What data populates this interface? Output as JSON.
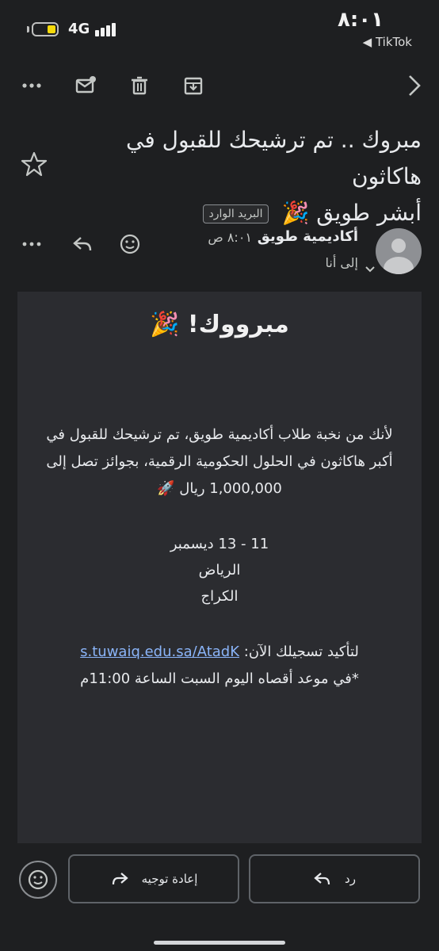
{
  "status_bar": {
    "network": "4G",
    "time": "٨:٠١",
    "source_app": "TikTok",
    "battery_color": "#f5d90a"
  },
  "toolbar": {
    "icons": [
      "more-icon",
      "mark-unread-icon",
      "delete-icon",
      "archive-icon",
      "next-chevron-icon"
    ]
  },
  "email": {
    "subject_line1": "مبروك .. تم ترشيحك للقبول في هاكاثون",
    "subject_line2": "أبشر طويق 🎉",
    "label": "البريد الوارد",
    "sender": {
      "name": "أكاديمية طويق",
      "time": "٨:٠١ ص",
      "recipient": "إلى أنا"
    },
    "body": {
      "title": "مبرووك! 🎉",
      "paragraph": "لأنك من نخبة طلاب أكاديمية طويق، تم ترشيحك للقبول في أكبر هاكاثون في الحلول الحكومية الرقمية، بجوائز تصل إلى 1,000,000 ريال 🚀",
      "date": "11 - 13 ديسمبر",
      "city": "الرياض",
      "venue": "الكراج",
      "confirm_prefix": "لتأكيد تسجيلك الآن:",
      "confirm_link": "s.tuwaiq.edu.sa/AtadK",
      "deadline": "*في موعد أقصاه اليوم السبت الساعة 11:00م"
    }
  },
  "actions": {
    "reply_label": "رد",
    "forward_label": "إعادة توجيه"
  },
  "colors": {
    "background": "#1e1f21",
    "card": "#2b2c30",
    "link": "#8ab4f8"
  }
}
